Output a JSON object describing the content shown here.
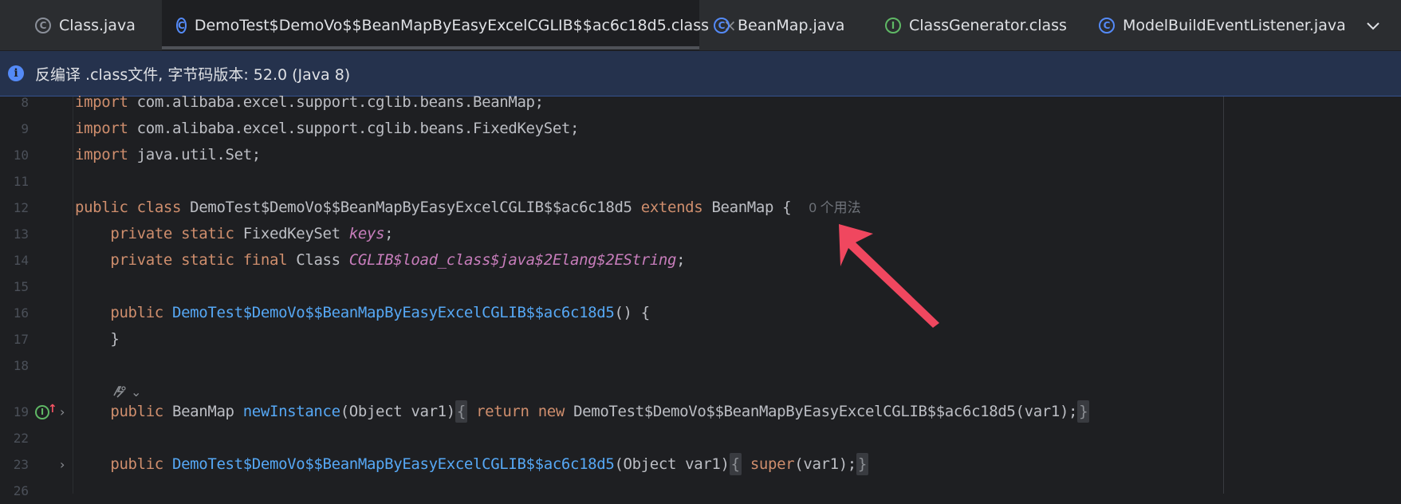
{
  "tabs": [
    {
      "label": "Class.java",
      "icon": "compiled-class-icon",
      "active": false
    },
    {
      "label": "DemoTest$DemoVo$$BeanMapByEasyExcelCGLIB$$ac6c18d5.class",
      "icon": "class-icon",
      "active": true,
      "close": "×"
    },
    {
      "label": "BeanMap.java",
      "icon": "class-icon",
      "active": false
    },
    {
      "label": "ClassGenerator.class",
      "icon": "interface-icon",
      "active": false
    },
    {
      "label": "ModelBuildEventListener.java",
      "icon": "class-icon",
      "active": false
    }
  ],
  "tab_icon_glyphs": {
    "class": "C",
    "interface": "I"
  },
  "banner": {
    "icon": "info-icon",
    "text": "反编译 .class文件, 字节码版本: 52.0 (Java 8)"
  },
  "editor": {
    "lines": [
      {
        "num": "8",
        "text": [
          "import",
          " com.alibaba.excel.support.cglib.beans.BeanMap;"
        ]
      },
      {
        "num": "9",
        "text": [
          "import",
          " com.alibaba.excel.support.cglib.beans.FixedKeySet;"
        ]
      },
      {
        "num": "10",
        "text": [
          "import",
          " java.util.Set;"
        ]
      },
      {
        "num": "11"
      },
      {
        "num": "12",
        "text": [
          "public",
          "class",
          " DemoTest$DemoVo$$BeanMapByEasyExcelCGLIB$$ac6c18d5 ",
          "extends",
          " BeanMap {  "
        ],
        "hint": "0 个用法"
      },
      {
        "num": "13",
        "text": [
          "    ",
          "private",
          "static",
          " FixedKeySet ",
          "keys",
          ";"
        ]
      },
      {
        "num": "14",
        "text": [
          "    ",
          "private",
          "static",
          "final",
          " Class ",
          "CGLIB$load_class$java$2Elang$2EString",
          ";"
        ]
      },
      {
        "num": "15"
      },
      {
        "num": "16",
        "text": [
          "    ",
          "public",
          " ",
          "DemoTest$DemoVo$$BeanMapByEasyExcelCGLIB$$ac6c18d5",
          "() {"
        ]
      },
      {
        "num": "17",
        "text": [
          "    }"
        ]
      },
      {
        "num": "18"
      },
      {
        "num": "19",
        "text": [
          "    ",
          "public",
          " BeanMap ",
          "newInstance",
          "(Object var1)",
          "{",
          " ",
          "return",
          "new",
          " DemoTest$DemoVo$$BeanMapByEasyExcelCGLIB$$ac6c18d5(var1);",
          "}"
        ]
      },
      {
        "num": "22"
      },
      {
        "num": "23",
        "text": [
          "    ",
          "public",
          " ",
          "DemoTest$DemoVo$$BeanMapByEasyExcelCGLIB$$ac6c18d5",
          "(Object var1)",
          "{",
          " ",
          "super",
          "(var1);",
          "}"
        ]
      },
      {
        "num": "26"
      }
    ],
    "gutter_glyphs": {
      "override": "I",
      "override_arrow": "↑",
      "fold": "›",
      "inlay_chevron": "⌄"
    }
  },
  "colors": {
    "keyword": "#cf8e6d",
    "field": "#c77dbb",
    "method": "#56a8f5",
    "annotation_arrow": "#f0475f",
    "banner_bg": "#25324d"
  }
}
